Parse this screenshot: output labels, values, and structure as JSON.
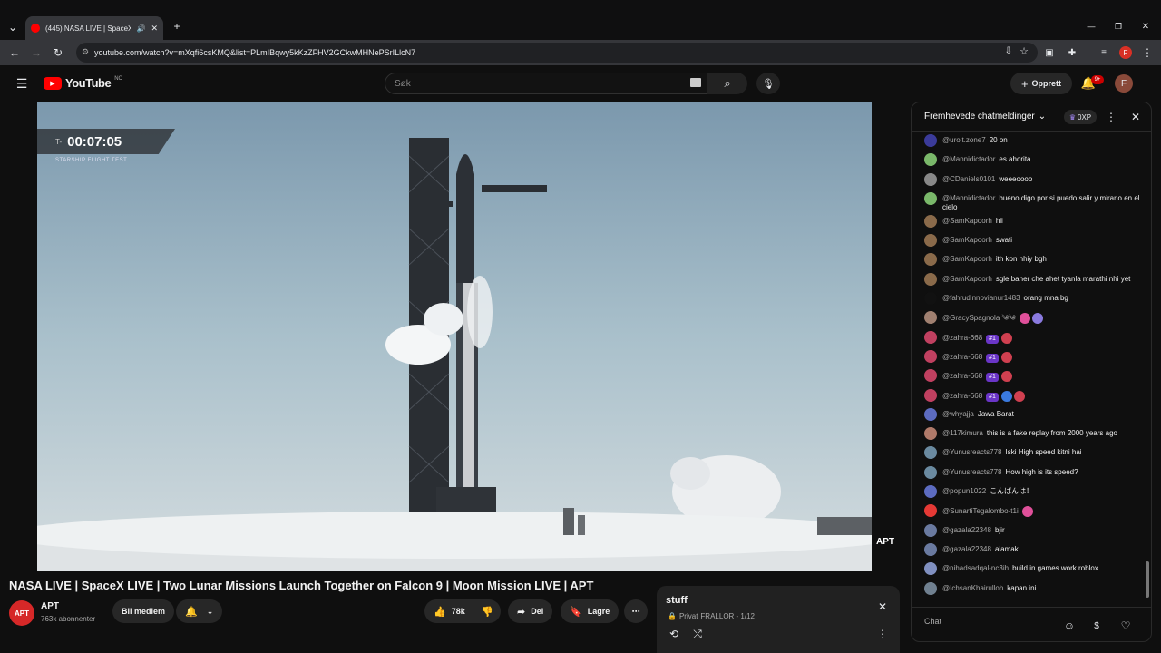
{
  "browser": {
    "tab_title": "(445) NASA LIVE | SpaceX LI",
    "url": "youtube.com/watch?v=mXqfi6csKMQ&list=PLmIBqwy5kKzZFHV2GCkwMHNePSrILlcN7"
  },
  "header": {
    "logo_text": "YouTube",
    "region": "NO",
    "search_placeholder": "Søk",
    "create_label": "Opprett",
    "notifications_count": "9+",
    "profile_initial": "F"
  },
  "video": {
    "countdown_prefix": "T-",
    "countdown": "00:07:05",
    "overlay_subtitle": "STARSHIP FLIGHT TEST",
    "corner_logo": "APT",
    "title": "NASA LIVE | SpaceX LIVE | Two Lunar Missions Launch Together on Falcon 9 | Moon Mission LIVE | APT"
  },
  "channel": {
    "avatar_text": "APT",
    "name": "APT",
    "subscribers": "763k abonnenter",
    "join_label": "Bli medlem"
  },
  "actions": {
    "likes": "78k",
    "share": "Del",
    "save": "Lagre"
  },
  "playlist": {
    "title": "stuff",
    "privacy": "Privat",
    "owner_progress": "FRALLOR - 1/12"
  },
  "chat": {
    "header": "Fremhevede chatmeldinger",
    "points": "0XP",
    "input_placeholder": "Chat",
    "messages": [
      {
        "author": "@urolt.zone7",
        "text": "20 on",
        "color": "#3b3b9a",
        "badges": []
      },
      {
        "author": "@Mannidictador",
        "text": "es ahorita",
        "color": "#7ab86a",
        "badges": []
      },
      {
        "author": "@CDaniels0101",
        "text": "weeeoooo",
        "color": "#888888",
        "badges": []
      },
      {
        "author": "@Mannidictador",
        "text": "bueno digo por si puedo salir y mirarlo en el cielo",
        "color": "#7ab86a",
        "badges": []
      },
      {
        "author": "@SamKapoorh",
        "text": "hii",
        "color": "#8a6a4a",
        "badges": []
      },
      {
        "author": "@SamKapoorh",
        "text": "swati",
        "color": "#8a6a4a",
        "badges": []
      },
      {
        "author": "@SamKapoorh",
        "text": "ith kon nhiy bgh",
        "color": "#8a6a4a",
        "badges": []
      },
      {
        "author": "@SamKapoorh",
        "text": "sgle baher che ahet tyanla marathi nhi yet",
        "color": "#8a6a4a",
        "badges": []
      },
      {
        "author": "@fahrudinnovianur1483",
        "text": "orang mna bg",
        "color": "#111111",
        "badges": []
      },
      {
        "author": "@GracySpagnola ༄༄",
        "text": "",
        "color": "#a08070",
        "badges": [],
        "emojis": [
          "#e0509a",
          "#8a7adf"
        ]
      },
      {
        "author": "@zahra-668",
        "text": "",
        "color": "#c04060",
        "badges": [
          "#1"
        ],
        "emojis": [
          "#d04050"
        ]
      },
      {
        "author": "@zahra-668",
        "text": "",
        "color": "#c04060",
        "badges": [
          "#1"
        ],
        "emojis": [
          "#d04050"
        ]
      },
      {
        "author": "@zahra-668",
        "text": "",
        "color": "#c04060",
        "badges": [
          "#1"
        ],
        "emojis": [
          "#d04050"
        ]
      },
      {
        "author": "@zahra-668",
        "text": "",
        "color": "#c04060",
        "badges": [
          "#1"
        ],
        "emojis": [
          "#3a7adf",
          "#d04050"
        ]
      },
      {
        "author": "@whyajja",
        "text": "Jawa Barat",
        "color": "#5c6bc0",
        "badges": []
      },
      {
        "author": "@117kimura",
        "text": "this is a fake replay from 2000 years ago",
        "color": "#b07a6a",
        "badges": []
      },
      {
        "author": "@Yunusreacts778",
        "text": "Iski High speed kitni hai",
        "color": "#6a8aa0",
        "badges": []
      },
      {
        "author": "@Yunusreacts778",
        "text": "How high is its speed?",
        "color": "#6a8aa0",
        "badges": []
      },
      {
        "author": "@popun1022",
        "text": "こんばんは！",
        "color": "#5c6bc0",
        "badges": []
      },
      {
        "author": "@SunartiTegalombo-t1i",
        "text": "",
        "color": "#e53935",
        "badges": [],
        "emojis": [
          "#e0509a"
        ]
      },
      {
        "author": "@gazala22348",
        "text": "bjir",
        "color": "#6a7aa0",
        "badges": []
      },
      {
        "author": "@gazala22348",
        "text": "alamak",
        "color": "#6a7aa0",
        "badges": []
      },
      {
        "author": "@nihadsadqal-nc3ih",
        "text": "build in games work roblox",
        "color": "#8090c0",
        "badges": []
      },
      {
        "author": "@IchsanKhairulloh",
        "text": "kapan ini",
        "color": "#708090",
        "badges": []
      }
    ]
  }
}
